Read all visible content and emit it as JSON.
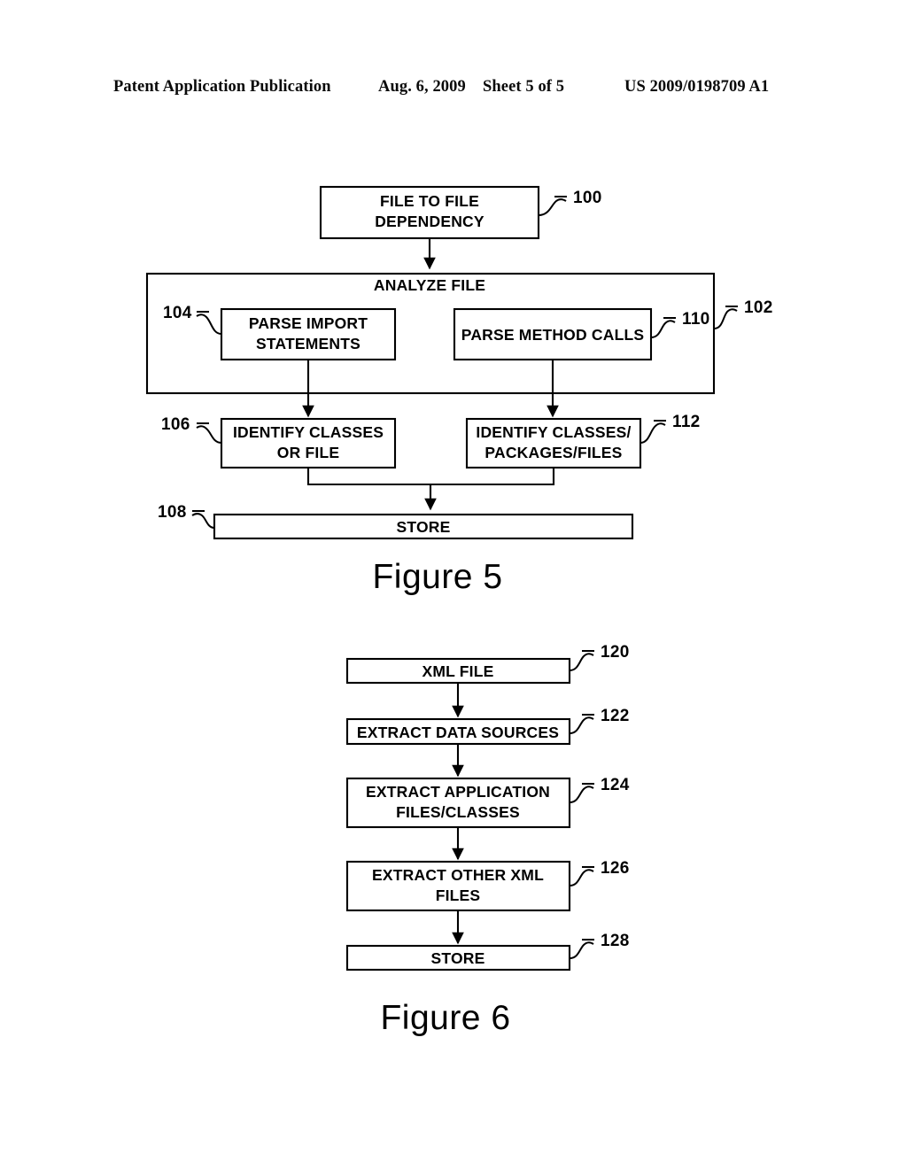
{
  "header": {
    "publication": "Patent Application Publication",
    "date": "Aug. 6, 2009",
    "sheet": "Sheet 5 of 5",
    "patent_number": "US 2009/0198709 A1"
  },
  "figure5": {
    "caption": "Figure 5",
    "nodes": {
      "start": {
        "label_line1": "FILE TO FILE",
        "label_line2": "DEPENDENCY",
        "ref": "100"
      },
      "container": {
        "label": "ANALYZE FILE",
        "ref": "102"
      },
      "parse_import": {
        "label_line1": "PARSE IMPORT",
        "label_line2": "STATEMENTS",
        "ref": "104"
      },
      "parse_method": {
        "label": "PARSE METHOD CALLS",
        "ref": "110"
      },
      "identify_left": {
        "label_line1": "IDENTIFY CLASSES",
        "label_line2": "OR FILE",
        "ref": "106"
      },
      "identify_right": {
        "label_line1": "IDENTIFY CLASSES/",
        "label_line2": "PACKAGES/FILES",
        "ref": "112"
      },
      "store": {
        "label": "STORE",
        "ref": "108"
      }
    }
  },
  "figure6": {
    "caption": "Figure 6",
    "nodes": {
      "xml_file": {
        "label": "XML FILE",
        "ref": "120"
      },
      "extract_sources": {
        "label": "EXTRACT DATA SOURCES",
        "ref": "122"
      },
      "extract_app": {
        "label_line1": "EXTRACT APPLICATION",
        "label_line2": "FILES/CLASSES",
        "ref": "124"
      },
      "extract_other": {
        "label_line1": "EXTRACT OTHER XML",
        "label_line2": "FILES",
        "ref": "126"
      },
      "store": {
        "label": "STORE",
        "ref": "128"
      }
    }
  }
}
